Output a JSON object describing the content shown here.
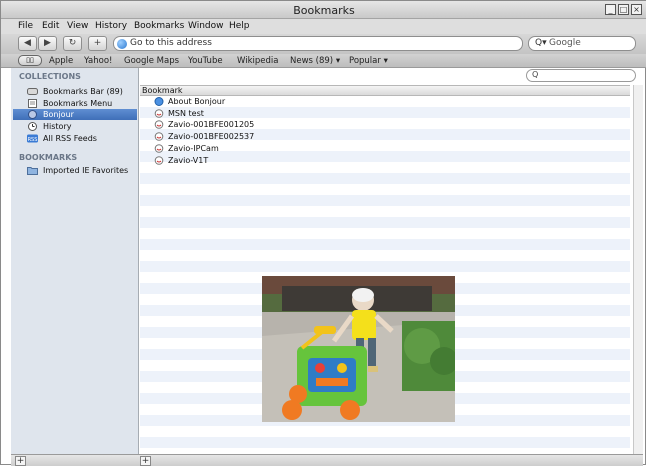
{
  "window": {
    "title": "Bookmarks"
  },
  "menu": [
    "File",
    "Edit",
    "View",
    "History",
    "Bookmarks",
    "Window",
    "Help"
  ],
  "toolbar": {
    "back": "◀",
    "forward": "▶",
    "reload": "↻",
    "add": "+",
    "address_placeholder": "Go to this address",
    "search_placeholder": "Google"
  },
  "bookmarks_bar": [
    "Apple",
    "Yahoo!",
    "Google Maps",
    "YouTube",
    "Wikipedia",
    "News (89) ▾",
    "Popular ▾"
  ],
  "sidebar": {
    "collections_label": "COLLECTIONS",
    "collections": [
      {
        "label": "Bookmarks Bar (89)",
        "icon": "bookmarks-bar-icon"
      },
      {
        "label": "Bookmarks Menu",
        "icon": "bookmarks-menu-icon"
      },
      {
        "label": "Bonjour",
        "icon": "bonjour-icon",
        "selected": true
      },
      {
        "label": "History",
        "icon": "history-clock-icon"
      },
      {
        "label": "All RSS Feeds",
        "icon": "rss-icon"
      }
    ],
    "bookmarks_label": "BOOKMARKS",
    "bookmarks": [
      {
        "label": "Imported IE Favorites",
        "icon": "folder-icon"
      }
    ]
  },
  "list": {
    "column_header": "Bookmark",
    "rows": [
      {
        "label": "About Bonjour",
        "icon": "info-globe-icon"
      },
      {
        "label": "MSN test",
        "icon": "bonjour-service-icon"
      },
      {
        "label": "Zavio-001BFE001205",
        "icon": "bonjour-service-icon"
      },
      {
        "label": "Zavio-001BFE002537",
        "icon": "bonjour-service-icon"
      },
      {
        "label": "Zavio-IPCam",
        "icon": "bonjour-service-icon"
      },
      {
        "label": "Zavio-V1T",
        "icon": "bonjour-service-icon"
      }
    ]
  },
  "colors": {
    "selection": "#3f6fb8",
    "sidebar_bg": "#dfe5ed",
    "stripe": "#edf2fa"
  }
}
